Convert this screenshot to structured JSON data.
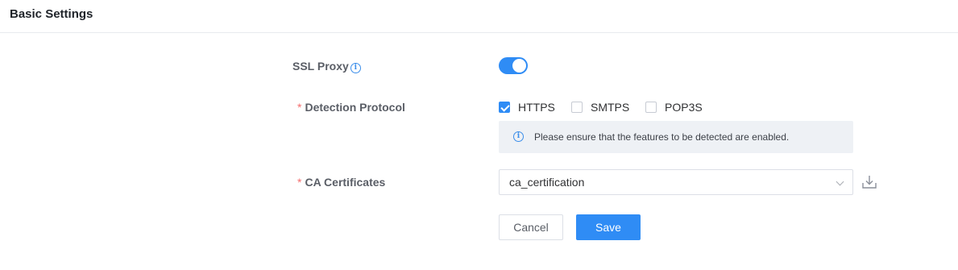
{
  "header": {
    "title": "Basic Settings"
  },
  "ssl_proxy": {
    "label": "SSL Proxy",
    "enabled": true,
    "info_icon": "info-icon"
  },
  "detection_protocol": {
    "required_mark": "*",
    "label": "Detection Protocol",
    "options": [
      {
        "label": "HTTPS",
        "checked": true
      },
      {
        "label": "SMTPS",
        "checked": false
      },
      {
        "label": "POP3S",
        "checked": false
      }
    ],
    "notice": {
      "icon": "info-icon",
      "text": "Please ensure that the features to be detected are enabled."
    }
  },
  "ca_certificates": {
    "required_mark": "*",
    "label": "CA Certificates",
    "selected_value": "ca_certification",
    "download_icon": "download-icon"
  },
  "buttons": {
    "cancel": "Cancel",
    "save": "Save"
  },
  "colors": {
    "accent": "#2f8cf5",
    "required": "#f56c6c",
    "notice_bg": "#eef1f5"
  }
}
